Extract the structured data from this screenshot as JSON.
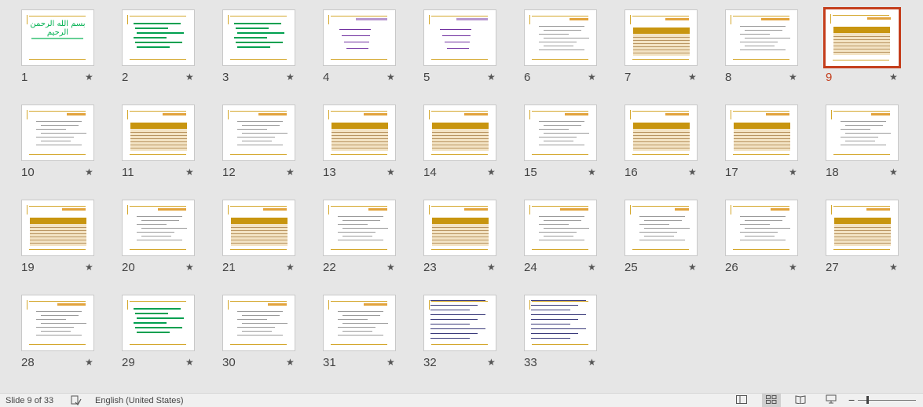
{
  "slides": [
    {
      "number": "1",
      "kind": "title"
    },
    {
      "number": "2",
      "kind": "dense-green"
    },
    {
      "number": "3",
      "kind": "list-green"
    },
    {
      "number": "4",
      "kind": "purple"
    },
    {
      "number": "5",
      "kind": "purple-list"
    },
    {
      "number": "6",
      "kind": "text"
    },
    {
      "number": "7",
      "kind": "table"
    },
    {
      "number": "8",
      "kind": "text"
    },
    {
      "number": "9",
      "kind": "table"
    },
    {
      "number": "10",
      "kind": "text"
    },
    {
      "number": "11",
      "kind": "table"
    },
    {
      "number": "12",
      "kind": "text"
    },
    {
      "number": "13",
      "kind": "table"
    },
    {
      "number": "14",
      "kind": "table"
    },
    {
      "number": "15",
      "kind": "text"
    },
    {
      "number": "16",
      "kind": "table"
    },
    {
      "number": "17",
      "kind": "table"
    },
    {
      "number": "18",
      "kind": "text"
    },
    {
      "number": "19",
      "kind": "table"
    },
    {
      "number": "20",
      "kind": "text"
    },
    {
      "number": "21",
      "kind": "table"
    },
    {
      "number": "22",
      "kind": "text"
    },
    {
      "number": "23",
      "kind": "table"
    },
    {
      "number": "24",
      "kind": "text"
    },
    {
      "number": "25",
      "kind": "text"
    },
    {
      "number": "26",
      "kind": "text"
    },
    {
      "number": "27",
      "kind": "table"
    },
    {
      "number": "28",
      "kind": "text"
    },
    {
      "number": "29",
      "kind": "green-text"
    },
    {
      "number": "30",
      "kind": "text"
    },
    {
      "number": "31",
      "kind": "text"
    },
    {
      "number": "32",
      "kind": "english"
    },
    {
      "number": "33",
      "kind": "english2"
    }
  ],
  "selected_slide": "9",
  "slide1": {
    "title": "بسم الله الرحمن الرحیم"
  },
  "status": {
    "slide_counter": "Slide 9 of 33",
    "language": "English (United States)"
  },
  "colors": {
    "selection": "#c43e1c",
    "accent": "#d4a72c"
  }
}
